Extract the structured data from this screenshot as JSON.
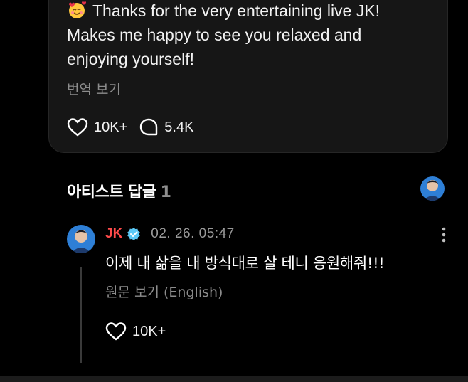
{
  "post": {
    "emoji_icon": "smiling-face-with-hearts-icon",
    "text_line1": "Thanks for the very entertaining live JK!",
    "text_line2": "Makes me happy to see you relaxed and",
    "text_line3": "enjoying yourself!",
    "translate_label": "번역 보기",
    "likes": "10K+",
    "comments": "5.4K"
  },
  "artist_replies": {
    "title": "아티스트 답글",
    "count": "1"
  },
  "reply": {
    "author": "JK",
    "timestamp": "02. 26. 05:47",
    "text": "이제 내 삶을 내 방식대로 살 테니 응원해줘!!!",
    "original_label": "원문 보기",
    "original_lang": "(English)",
    "likes": "10K+"
  },
  "colors": {
    "background": "#000000",
    "card": "#161616",
    "author_red": "#ff4b4b",
    "verified_blue": "#5bc8f5",
    "muted": "#8c8c8c"
  }
}
